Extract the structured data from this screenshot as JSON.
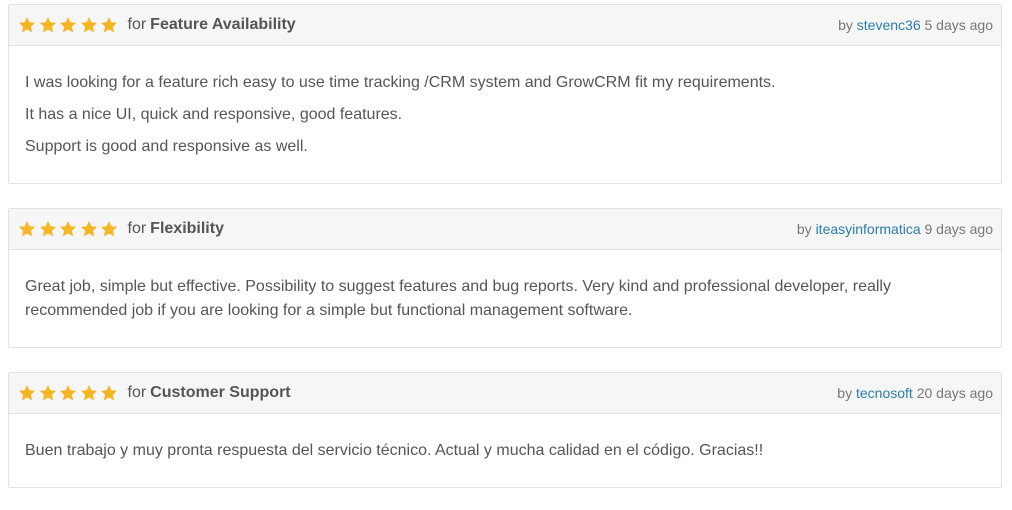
{
  "reviews": [
    {
      "rating": 5,
      "for_label": "for",
      "category": "Feature Availability",
      "by_label": "by",
      "author": "stevenc36",
      "time_ago": "5 days ago",
      "paragraphs": [
        "I was looking for a feature rich easy to use time tracking /CRM system and GrowCRM fit my requirements.",
        "It has a nice UI, quick and responsive, good features.",
        "Support is good and responsive as well."
      ]
    },
    {
      "rating": 5,
      "for_label": "for",
      "category": "Flexibility",
      "by_label": "by",
      "author": "iteasyinformatica",
      "time_ago": "9 days ago",
      "paragraphs": [
        "Great job, simple but effective. Possibility to suggest features and bug reports. Very kind and professional developer, really recommended job if you are looking for a simple but functional management software."
      ]
    },
    {
      "rating": 5,
      "for_label": "for",
      "category": "Customer Support",
      "by_label": "by",
      "author": "tecnosoft",
      "time_ago": "20 days ago",
      "paragraphs": [
        "Buen trabajo y muy pronta respuesta del servicio técnico. Actual y mucha calidad en el código. Gracias!!"
      ]
    }
  ],
  "colors": {
    "star": "#f5b623",
    "author_link": "#2a7fa8",
    "header_bg": "#f6f6f6"
  }
}
